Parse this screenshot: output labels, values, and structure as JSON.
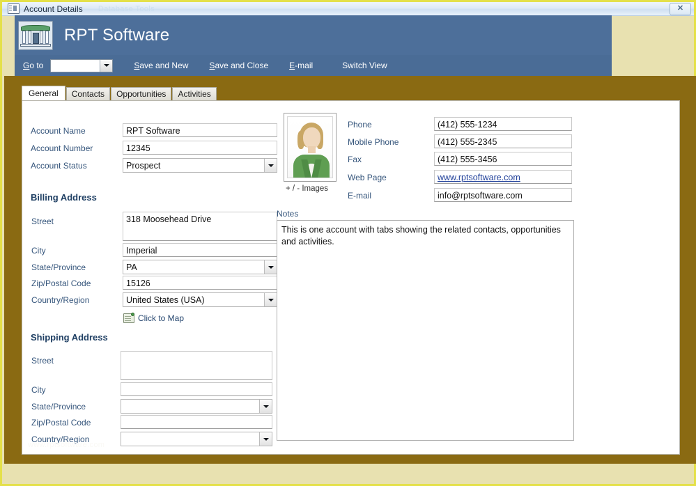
{
  "window": {
    "title": "Account Details",
    "icon": "form-icon",
    "close_label": "✕",
    "ghost_text": "Database Tools"
  },
  "header": {
    "title": "RPT Software",
    "logo_icon": "bank-building-icon",
    "bg_color": "#4d6f9a"
  },
  "toolbar": {
    "goto_label": "Go to",
    "goto_value": "",
    "buttons": [
      {
        "label": "Save and New",
        "accesskey": "S"
      },
      {
        "label": "Save and Close",
        "accesskey": "S"
      },
      {
        "label": "E-mail",
        "accesskey": "E"
      },
      {
        "label": "Switch View",
        "accesskey": ""
      }
    ],
    "bg_color": "#4a6c96"
  },
  "tabs": [
    {
      "label": "General",
      "active": true
    },
    {
      "label": "Contacts",
      "active": false
    },
    {
      "label": "Opportunities",
      "active": false
    },
    {
      "label": "Activities",
      "active": false
    }
  ],
  "form": {
    "account": {
      "name_label": "Account Name",
      "name_value": "RPT Software",
      "number_label": "Account Number",
      "number_value": "12345",
      "status_label": "Account Status",
      "status_value": "Prospect"
    },
    "billing": {
      "section_label": "Billing Address",
      "street_label": "Street",
      "street_value": "318 Moosehead Drive",
      "city_label": "City",
      "city_value": "Imperial",
      "state_label": "State/Province",
      "state_value": "PA",
      "zip_label": "Zip/Postal Code",
      "zip_value": "15126",
      "country_label": "Country/Region",
      "country_value": "United States (USA)",
      "map_link": "Click to Map",
      "map_icon": "map-icon"
    },
    "shipping": {
      "section_label": "Shipping Address",
      "street_label": "Street",
      "street_value": "",
      "city_label": "City",
      "city_value": "",
      "state_label": "State/Province",
      "state_value": "",
      "zip_label": "Zip/Postal Code",
      "zip_value": "",
      "country_label": "Country/Region",
      "country_value": ""
    },
    "contact": {
      "photo_icon": "person-photo",
      "images_label": "+ / -  Images",
      "phone_label": "Phone",
      "phone_value": "(412) 555-1234",
      "mobile_label": "Mobile Phone",
      "mobile_value": "(412) 555-2345",
      "fax_label": "Fax",
      "fax_value": "(412) 555-3456",
      "web_label": "Web Page",
      "web_value": "www.rptsoftware.com",
      "email_label": "E-mail",
      "email_value": "info@rptsoftware.com"
    },
    "notes": {
      "label": "Notes",
      "value": "This is one account with tabs showing the related contacts, opportunities and activities."
    },
    "watermark": "www.rptsoftware.com"
  }
}
